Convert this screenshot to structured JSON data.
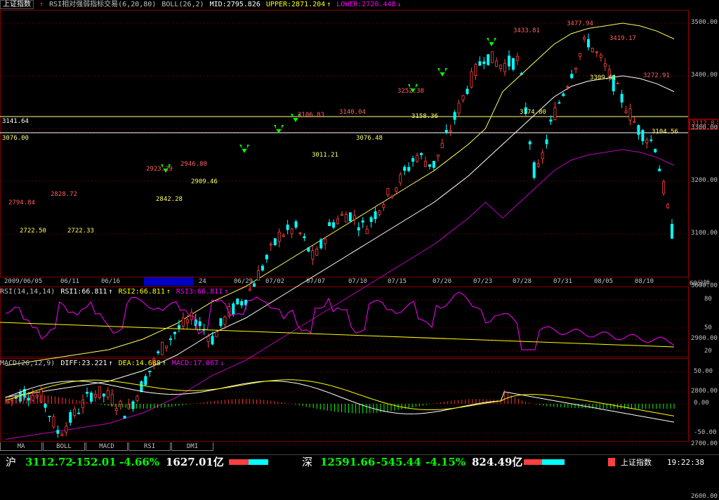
{
  "header": {
    "index_name": "上证指数",
    "indicator": "RSI相对强弱指标交易(6,20,80)",
    "boll": "BOLL(26,2)",
    "mid": "MID:2795.826",
    "upper": "UPPER:2871.204",
    "lower": "LOWER:2720.448"
  },
  "rsi_header": {
    "label": "RSI(14,14,14)",
    "rsi1": "RSI1:66.811",
    "rsi2": "RSI2:66.811",
    "rsi3": "RSI3:66.811"
  },
  "macd_header": {
    "label": "MACD(26,12,9)",
    "diff": "DIFF:23.221",
    "dea": "DEA:14.688",
    "macd": "MACD:17.067"
  },
  "price_axis": [
    "3500.00",
    "3400.00",
    "3300.00",
    "3200.00",
    "3100.00",
    "3000.00",
    "2900.00",
    "2800.00",
    "2700.00",
    "2600.00"
  ],
  "rsi_axis": [
    "80",
    "50",
    "20"
  ],
  "macd_axis": [
    "50.00",
    "0.00",
    "-50.00"
  ],
  "cursor_price": "3112.8",
  "hline_left1": "3141.64",
  "hline_left2": "3076.00",
  "date_ticks": [
    "2009/06/05",
    "06/11",
    "06/16",
    "24",
    "06/29",
    "07/02",
    "07/07",
    "07/10",
    "07/15",
    "07/20",
    "07/23",
    "07/28",
    "07/31",
    "08/05",
    "08/10"
  ],
  "period": "60分钟",
  "price_labels": {
    "p1": "2794.84",
    "p2": "2828.72",
    "p3": "2722.50",
    "p4": "2722.33",
    "p5": "2923.29",
    "p6": "2946.80",
    "p7": "2842.28",
    "p8": "2909.46",
    "p9": "3106.83",
    "p10": "3011.21",
    "p11": "3140.04",
    "p12": "3076.48",
    "p13": "3252.38",
    "p14": "3158.36",
    "p15": "3433.81",
    "p16": "3477.94",
    "p17": "3419.17",
    "p18": "3309.61",
    "p19": "3272.91",
    "p20": "3174.80",
    "p21": "3104.56"
  },
  "tabs": [
    "MA",
    "BOLL",
    "MACD",
    "RSI",
    "DMI"
  ],
  "status": {
    "sh_label": "沪",
    "sh_value": "3112.72",
    "sh_change": "-152.01",
    "sh_pct": "-4.66%",
    "sh_amount": "1627.01亿",
    "sz_label": "深",
    "sz_value": "12591.66",
    "sz_change": "-545.44",
    "sz_pct": "-4.15%",
    "sz_amount": "824.49亿",
    "index_name": "上证指数",
    "time": "19:22:38"
  },
  "chart_data": {
    "type": "line",
    "title": "上证指数",
    "ylim": [
      2540,
      3540
    ],
    "series": [
      {
        "name": "BOLL MID",
        "values": [
          2790,
          2795,
          2800,
          2805,
          2810,
          2815,
          2820,
          2830,
          2840,
          2855,
          2870,
          2890,
          2910,
          2925,
          2940,
          2960,
          2980,
          3000,
          3020,
          3040,
          3060,
          3080,
          3100,
          3120,
          3140,
          3160,
          3185,
          3210,
          3240,
          3270,
          3300,
          3330,
          3360,
          3380,
          3390,
          3395,
          3400,
          3395,
          3385,
          3370
        ]
      },
      {
        "name": "close",
        "values": [
          2780,
          2800,
          2790,
          2720,
          2760,
          2800,
          2790,
          2760,
          2820,
          2880,
          2920,
          2940,
          2900,
          2950,
          2980,
          3040,
          3100,
          3110,
          3050,
          3120,
          3140,
          3110,
          3160,
          3200,
          3250,
          3230,
          3300,
          3380,
          3440,
          3420,
          3430,
          3200,
          3320,
          3400,
          3470,
          3420,
          3360,
          3300,
          3270,
          3104
        ]
      }
    ]
  }
}
